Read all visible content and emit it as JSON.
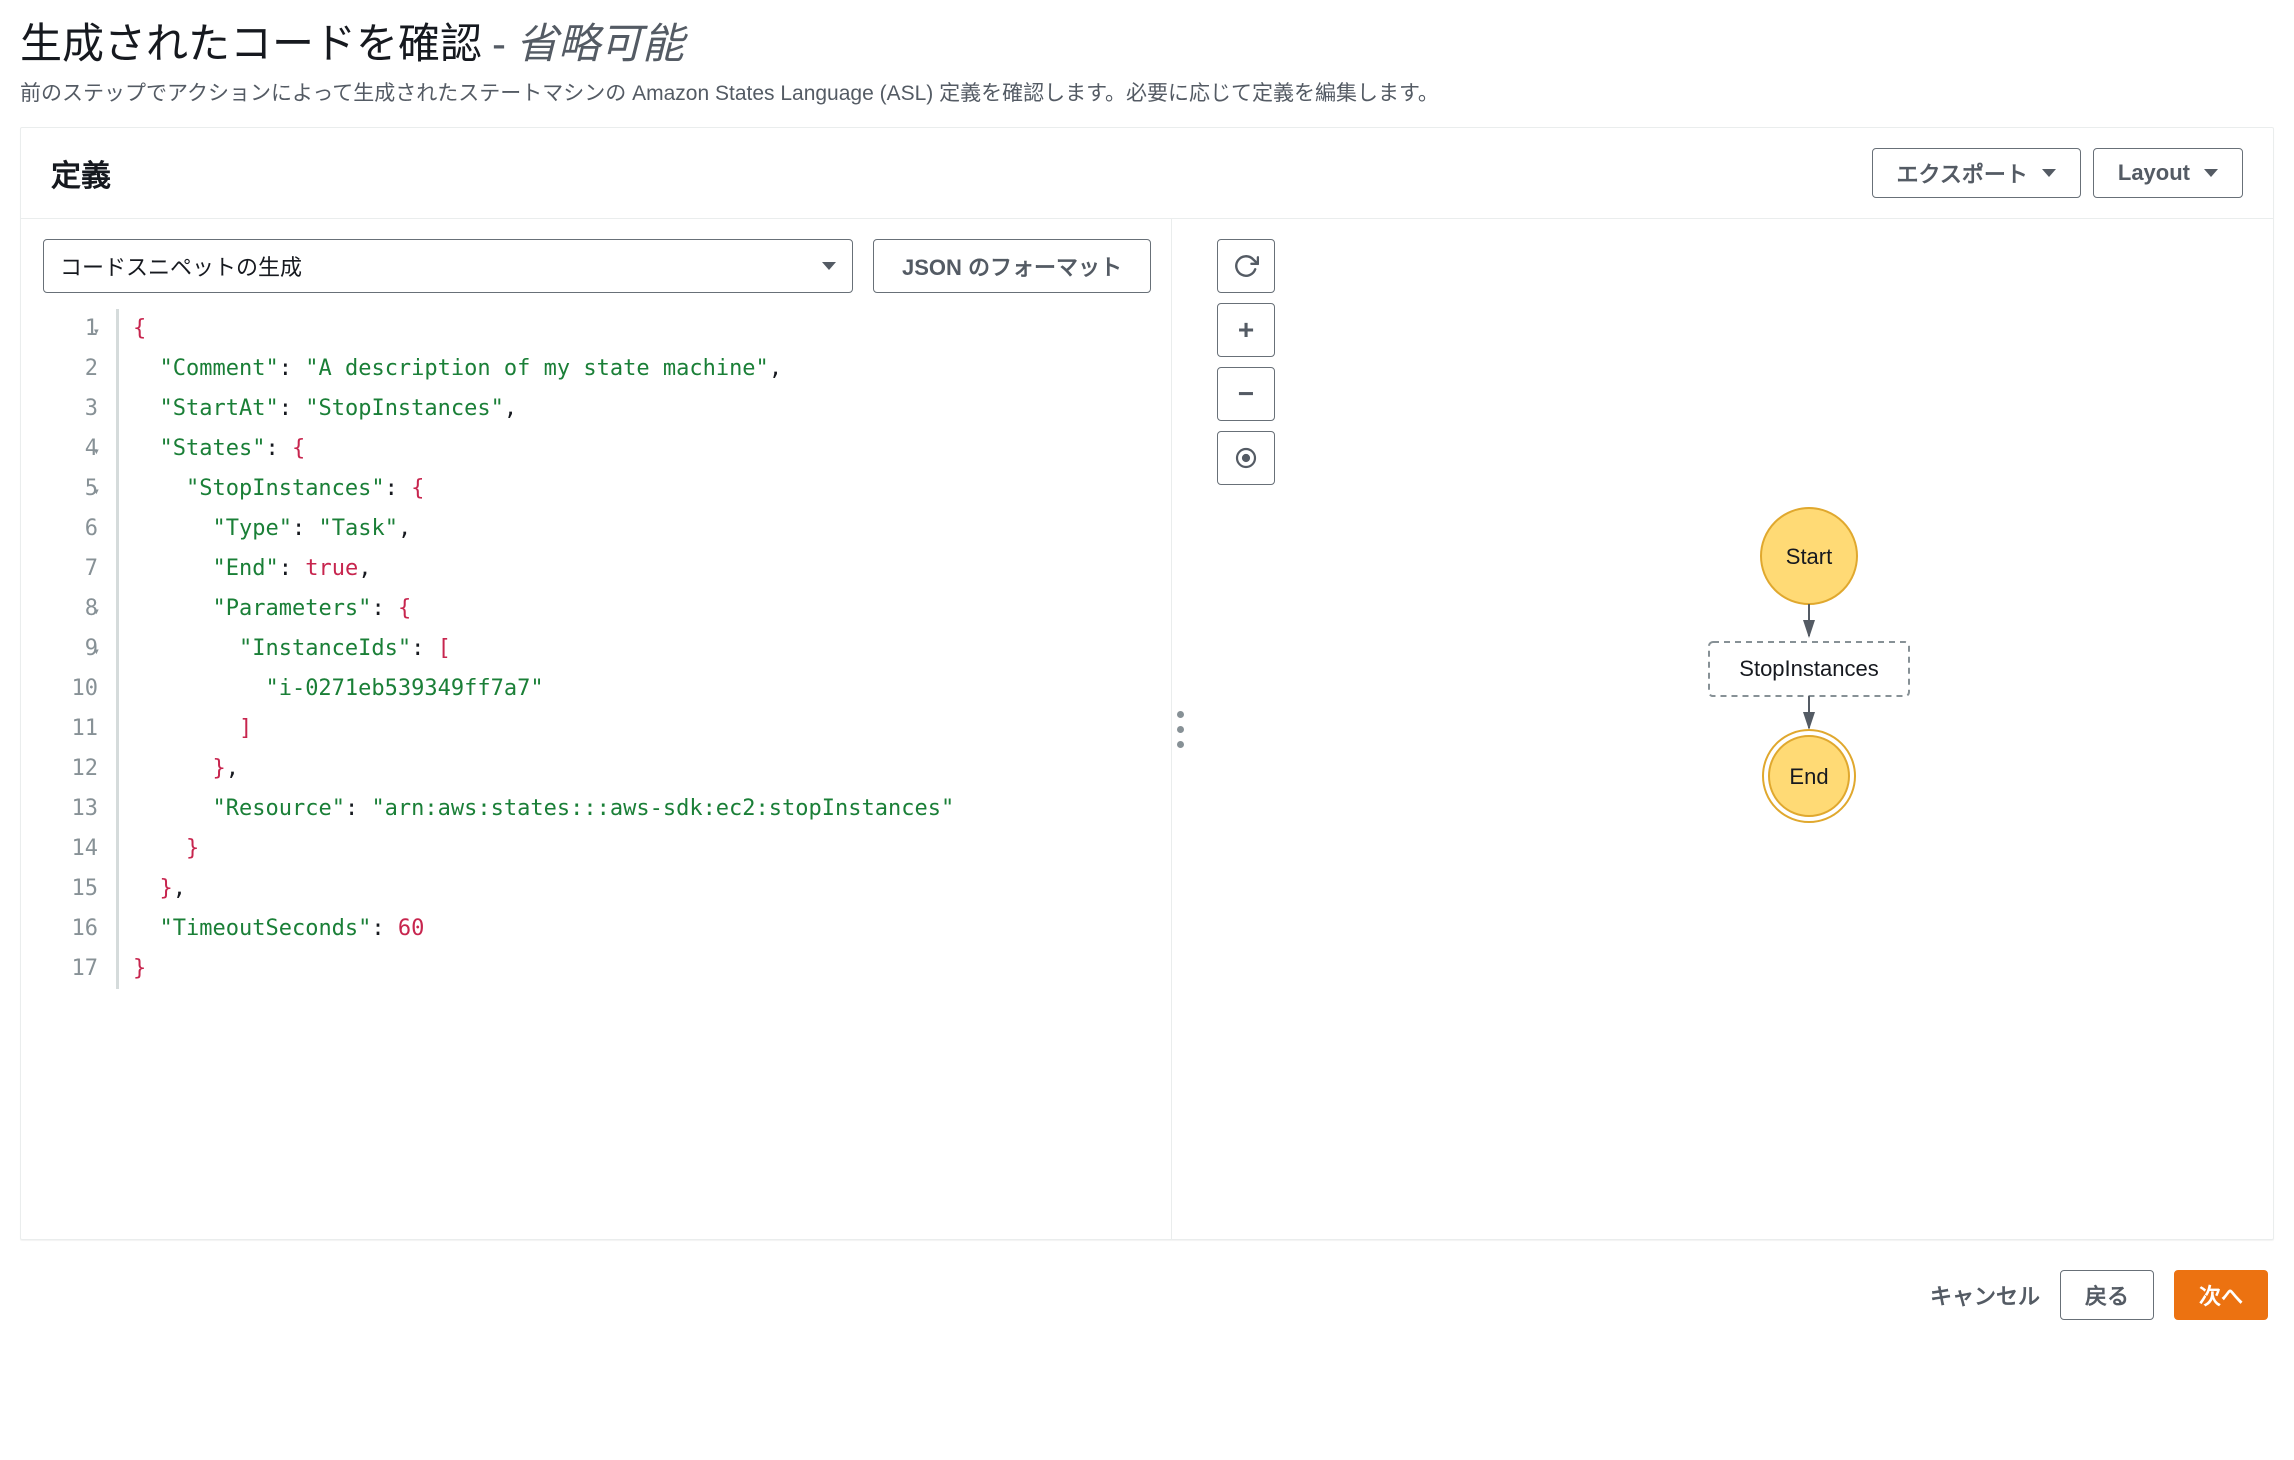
{
  "header": {
    "title_main": "生成されたコードを確認",
    "title_sep": "-",
    "title_sub": "省略可能",
    "description": "前のステップでアクションによって生成されたステートマシンの Amazon States Language (ASL) 定義を確認します。必要に応じて定義を編集します。"
  },
  "panel": {
    "title": "定義",
    "export_label": "エクスポート",
    "layout_label": "Layout"
  },
  "toolbar": {
    "snippet_select": "コードスニペットの生成",
    "format_button": "JSON のフォーマット"
  },
  "code": {
    "lines": [
      {
        "n": 1,
        "fold": true,
        "indent": 0,
        "t": [
          [
            "brace",
            "{"
          ]
        ]
      },
      {
        "n": 2,
        "fold": false,
        "indent": 1,
        "t": [
          [
            "key",
            "\"Comment\""
          ],
          [
            "punct",
            ": "
          ],
          [
            "str",
            "\"A description of my state machine\""
          ],
          [
            "punct",
            ","
          ]
        ]
      },
      {
        "n": 3,
        "fold": false,
        "indent": 1,
        "t": [
          [
            "key",
            "\"StartAt\""
          ],
          [
            "punct",
            ": "
          ],
          [
            "str",
            "\"StopInstances\""
          ],
          [
            "punct",
            ","
          ]
        ]
      },
      {
        "n": 4,
        "fold": true,
        "indent": 1,
        "t": [
          [
            "key",
            "\"States\""
          ],
          [
            "punct",
            ": "
          ],
          [
            "brace",
            "{"
          ]
        ]
      },
      {
        "n": 5,
        "fold": true,
        "indent": 2,
        "t": [
          [
            "key",
            "\"StopInstances\""
          ],
          [
            "punct",
            ": "
          ],
          [
            "brace",
            "{"
          ]
        ]
      },
      {
        "n": 6,
        "fold": false,
        "indent": 3,
        "t": [
          [
            "key",
            "\"Type\""
          ],
          [
            "punct",
            ": "
          ],
          [
            "str",
            "\"Task\""
          ],
          [
            "punct",
            ","
          ]
        ]
      },
      {
        "n": 7,
        "fold": false,
        "indent": 3,
        "t": [
          [
            "key",
            "\"End\""
          ],
          [
            "punct",
            ": "
          ],
          [
            "bool",
            "true"
          ],
          [
            "punct",
            ","
          ]
        ]
      },
      {
        "n": 8,
        "fold": true,
        "indent": 3,
        "t": [
          [
            "key",
            "\"Parameters\""
          ],
          [
            "punct",
            ": "
          ],
          [
            "brace",
            "{"
          ]
        ]
      },
      {
        "n": 9,
        "fold": true,
        "indent": 4,
        "t": [
          [
            "key",
            "\"InstanceIds\""
          ],
          [
            "punct",
            ": "
          ],
          [
            "brace",
            "["
          ]
        ]
      },
      {
        "n": 10,
        "fold": false,
        "indent": 5,
        "t": [
          [
            "str",
            "\"i-0271eb539349ff7a7\""
          ]
        ]
      },
      {
        "n": 11,
        "fold": false,
        "indent": 4,
        "t": [
          [
            "brace",
            "]"
          ]
        ]
      },
      {
        "n": 12,
        "fold": false,
        "indent": 3,
        "t": [
          [
            "brace",
            "}"
          ],
          [
            "punct",
            ","
          ]
        ]
      },
      {
        "n": 13,
        "fold": false,
        "indent": 3,
        "t": [
          [
            "key",
            "\"Resource\""
          ],
          [
            "punct",
            ": "
          ],
          [
            "str",
            "\"arn:aws:states:::aws-sdk:ec2:stopInstances\""
          ]
        ]
      },
      {
        "n": 14,
        "fold": false,
        "indent": 2,
        "t": [
          [
            "brace",
            "}"
          ]
        ]
      },
      {
        "n": 15,
        "fold": false,
        "indent": 1,
        "t": [
          [
            "brace",
            "}"
          ],
          [
            "punct",
            ","
          ]
        ]
      },
      {
        "n": 16,
        "fold": false,
        "indent": 1,
        "t": [
          [
            "key",
            "\"TimeoutSeconds\""
          ],
          [
            "punct",
            ": "
          ],
          [
            "num",
            "60"
          ]
        ]
      },
      {
        "n": 17,
        "fold": false,
        "indent": 0,
        "t": [
          [
            "brace",
            "}"
          ]
        ]
      }
    ]
  },
  "graph": {
    "start_label": "Start",
    "state_label": "StopInstances",
    "end_label": "End"
  },
  "footer": {
    "cancel": "キャンセル",
    "back": "戻る",
    "next": "次へ"
  },
  "colors": {
    "accent": "#ec7211",
    "node_fill": "#ffda75",
    "node_stroke": "#e0a82e"
  }
}
